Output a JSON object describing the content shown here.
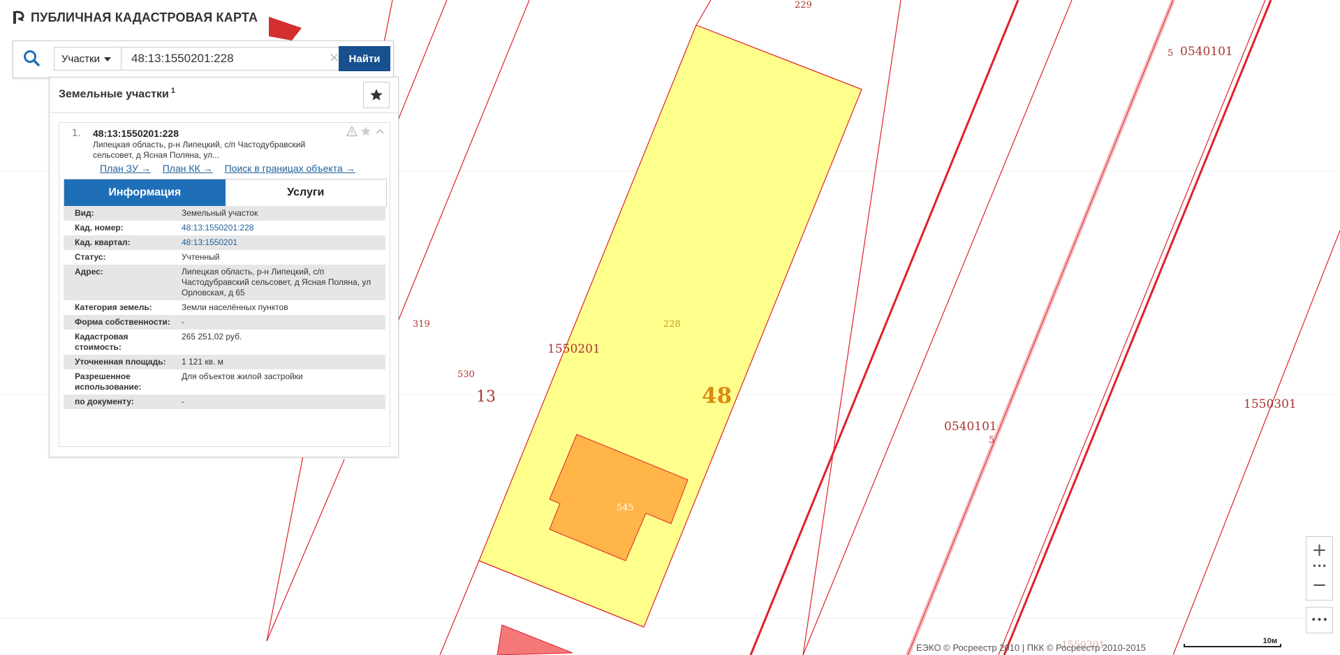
{
  "app": {
    "title": "ПУБЛИЧНАЯ КАДАСТРОВАЯ КАРТА"
  },
  "search": {
    "type_label": "Участки",
    "query": "48:13:1550201:228",
    "clear_symbol": "×",
    "find_label": "Найти"
  },
  "panel": {
    "title": "Земельные участки",
    "count": "1",
    "result": {
      "number": "1.",
      "id": "48:13:1550201:228",
      "address": "Липецкая область, р-н Липецкий, с/п Частодубравский сельсовет, д Ясная Поляна, ул...",
      "links": [
        "План ЗУ →",
        "План КК →",
        "Поиск в границах объекта →"
      ]
    },
    "tabs": {
      "info": "Информация",
      "services": "Услуги"
    },
    "rows": [
      {
        "key": "Вид:",
        "value": "Земельный участок"
      },
      {
        "key": "Кад. номер:",
        "value": "48:13:1550201:228"
      },
      {
        "key": "Кад. квартал:",
        "value": "48:13:1550201"
      },
      {
        "key": "Статус:",
        "value": "Учтенный"
      },
      {
        "key": "Адрес:",
        "value": "Липецкая область, р-н Липецкий, с/п Частодубравский сельсовет, д Ясная Поляна, ул Орловская, д 65"
      },
      {
        "key": "Категория земель:",
        "value": "Земли населённых пунктов"
      },
      {
        "key": "Форма собственности:",
        "value": "-"
      },
      {
        "key": "Кадастровая стоимость:",
        "value": "265 251,02 руб."
      },
      {
        "key": "Уточненная площадь:",
        "value": "1 121 кв. м"
      },
      {
        "key": "Разрешенное использование:",
        "value": "Для объектов жилой застройки"
      },
      {
        "key": "по документу:",
        "value": "-"
      }
    ]
  },
  "map": {
    "labels": {
      "parcel_229": "229",
      "parcel_228": "228",
      "parcel_319": "319",
      "parcel_530": "530",
      "quarter_1550201": "1550201",
      "district_13": "13",
      "region_48": "48",
      "building_545": "545",
      "quarter_0540101_top": "0540101",
      "quarter_0540101_mid": "0540101",
      "quarter_1550301": "1550301",
      "five_top": "5",
      "five_mid": "5",
      "bottom_partial": "1550301"
    },
    "colors": {
      "parcel_fill": "#ffff8c",
      "building_fill": "#ffb547",
      "boundary": "#e0202a",
      "label": "#a33333"
    }
  },
  "controls": {
    "zoom_in": "+",
    "zoom_out": "−",
    "dots": "•••",
    "more": "•••"
  },
  "footer": {
    "copyright": "ЕЭКО © Росреестр 2010 | ПКК © Росреестр 2010-2015",
    "scale_label": "10м"
  }
}
